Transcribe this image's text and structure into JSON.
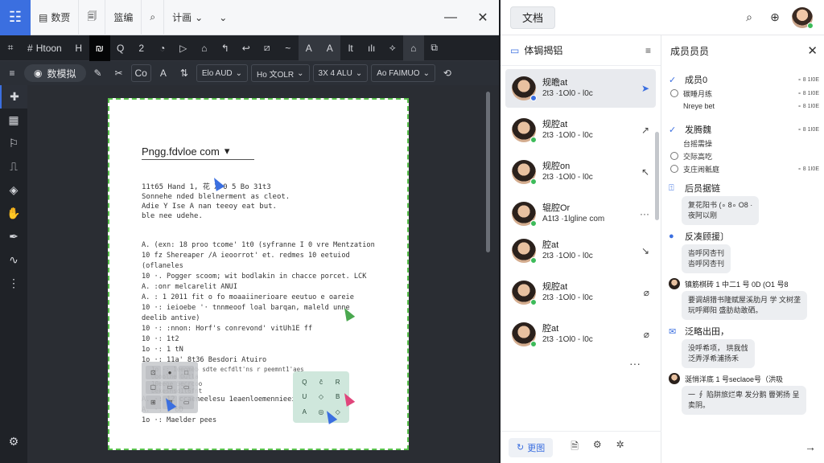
{
  "topbar": {
    "items": [
      {
        "label": "数贾",
        "icon": "doc-icon"
      },
      {
        "label": "",
        "icon": "clipboard-icon"
      },
      {
        "label": "篮编",
        "icon": ""
      },
      {
        "label": "",
        "icon": "search-icon"
      },
      {
        "label": "计画",
        "icon": ""
      }
    ],
    "dropdown_caret": "⌄"
  },
  "toolbar1": {
    "font_label": "Htoon",
    "items": [
      "H",
      "₪",
      "Q",
      "2",
      "◔",
      "▷",
      "⌂",
      "↰",
      "↩",
      "⧄",
      "~",
      "A",
      "A",
      "lt",
      "ılı",
      "⟡",
      "⌂",
      "⧉"
    ]
  },
  "toolbar2": {
    "mode_label": "数模拟",
    "dropdowns": [
      "Elo AUD",
      "Ho 文OLR",
      "3X 4 ALU",
      "Ao FAIMUO"
    ],
    "buttons": [
      "Co",
      "A",
      "⟲"
    ]
  },
  "document": {
    "title": "Pngg.fdvloe com",
    "intro_lines": [
      "11t65 Hand 1,  花 X'0 5 Bo 31t3",
      "Sonnehe nded blelnerment as cleot.",
      "Adie Y Ise A nan teeoy eat but.",
      "ble nee udehe."
    ],
    "list_lines": [
      "A. (exn: 18 proo tcome' 1t0 (syfranne I 0 vre Mentzation",
      "10 fz Shereaper /A ieoorrot' et. redmes 10 eetuiod (oflaneles",
      "10 ·. Pogger scoom; wit bodlakin in chacce porcet. LCK",
      "A. :onr melcarelit ANUI",
      "A. : 1 2011 fit o fo moaaiinerioare eeutuo e oareie",
      "10 ·: ieioebe '· tnnmeoof loal barqan, maleld unne deelib antive)",
      "10 ·: :nnon: Horf's conrevond' vitUh1E ff",
      "10 ·: 1t2",
      "1o ·: 1 tN",
      "1o ·: 11a' 8t36 Besdori Atuiro",
      "1o  ·:  1eeomeb sdte  ecfdlt'ns r  peemnt1'aes",
      "                     Uboolne Outla",
      "                     10eeoe 5ecrcoo",
      "                     bekeshsd1t6fnt",
      "A.  ·: 12 ccaeneelesu 1eaenloemennieei",
      "A.  ·: 1 8D",
      "1o  ·: Maelder pees"
    ],
    "grey_grid": [
      "⊡",
      "●",
      "□",
      "▢",
      "▭",
      "▭",
      "⊞",
      "⊠",
      "▭"
    ],
    "green_grid": [
      "Q",
      "ĉ",
      "R",
      "U",
      "◇",
      "B",
      "A",
      "◎",
      "◇"
    ]
  },
  "right_top": {
    "doc_button": "文档"
  },
  "collab": {
    "header": "体锔揭铝",
    "users": [
      {
        "name": "规瞻at",
        "meta": "2t3 ·1Ol0 - l0c",
        "action": "➤",
        "action_icon": "cursor-icon",
        "status": "blue"
      },
      {
        "name": "规腔at",
        "meta": "2t3 ·1Ol0 - l0c",
        "action": "↗",
        "action_icon": "arrow-icon",
        "status": "green"
      },
      {
        "name": "规腔on",
        "meta": "2t3 ·1Ol0 - l0c",
        "action": "↖",
        "action_icon": "pointer-icon",
        "status": "green"
      },
      {
        "name": "辊腔Or",
        "meta": "A1t3 ·1lgline com",
        "action": "···",
        "action_icon": "more-icon",
        "status": "green"
      },
      {
        "name": "腔at",
        "meta": "2t3 ·1Ol0 - l0c",
        "action": "↘",
        "action_icon": "arrow-icon",
        "status": "green"
      },
      {
        "name": "规腔at",
        "meta": "2t3 ·1Ol0 - l0c",
        "action": "⌀",
        "action_icon": "attach-icon",
        "status": "green"
      },
      {
        "name": "腔at",
        "meta": "2t3 ·1Ol0 - l0c",
        "action": "⌀",
        "action_icon": "attach-icon",
        "status": "green"
      }
    ],
    "more": "···",
    "share_label": "更图"
  },
  "activity": {
    "header": "成员员员",
    "sections": [
      {
        "title": "成员0",
        "meta": "∘ 8 1I0E",
        "tasks": [
          {
            "text": "碳睡月练",
            "meta": "∘ 8 1I0E"
          },
          {
            "text": "Nreye bet",
            "meta": "∘ 8 1I0E"
          }
        ]
      },
      {
        "title": "发腾魏",
        "meta": "∘ 8 1I0E",
        "tasks": [
          {
            "text": "台摇需操",
            "meta": ""
          },
          {
            "text": "交际高吃",
            "meta": ""
          },
          {
            "text": "支庄闹骶庭",
            "meta": "∘ 8 1I0E"
          }
        ]
      }
    ],
    "messages": [
      {
        "title": "后员据链",
        "lines": [
          "复花阳书  (∘ 8∘ O8 ·",
          "夜阿以刚"
        ]
      },
      {
        "title": "反凑顾援〕",
        "lines": [
          "沓呼冈杏刊",
          "沓呼冈杏刊"
        ]
      },
      {
        "title": "镇筋棋砖  1 中二1 号 0D  (O1 号8",
        "lines": [
          "要调胡猎书隆赋屋溪肋月 学 文树垄",
          "玩呼卿阳  盛肪劫敢硒。"
        ]
      },
      {
        "title": "泛略出田，",
        "lines": [
          "没呼希项，  珙我戗",
          "泛弄浮希浦扬禾"
        ]
      },
      {
        "title": "涎悄洋底  1 号seclaoe号（洪吸",
        "lines": [
          "一 ∮ 陷阱旅烂卑 发分鹅 罾粥扬 呈",
          "卖阴。"
        ]
      }
    ]
  },
  "colors": {
    "accent": "#3b6fe0",
    "status_online": "#3dbb5a",
    "dark_bg": "#262a31",
    "selection_green": "#5ac24d"
  }
}
